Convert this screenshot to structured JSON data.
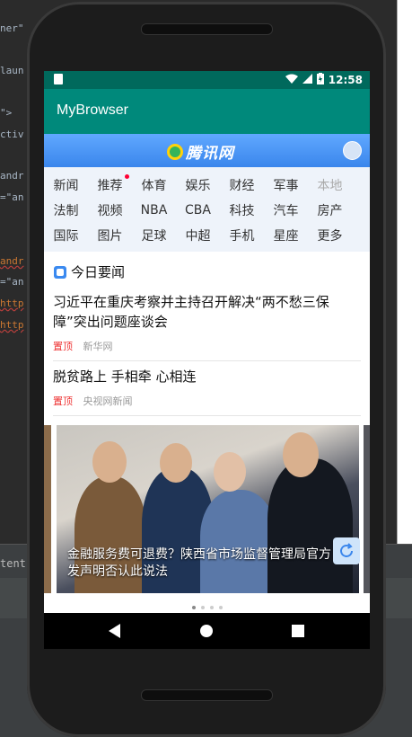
{
  "ide": {
    "left_lines": [
      "ner\"",
      "laun",
      "\">",
      "ctiv",
      "andr",
      "=\"an",
      "andr",
      "=\"an",
      "http",
      "http"
    ],
    "bottom_text": "tent-"
  },
  "status_bar": {
    "time": "12:58"
  },
  "app_bar": {
    "title": "MyBrowser"
  },
  "site_header": {
    "logo_text": "腾讯网"
  },
  "channels": [
    [
      {
        "label": "新闻"
      },
      {
        "label": "推荐",
        "dot": true
      },
      {
        "label": "体育"
      },
      {
        "label": "娱乐"
      },
      {
        "label": "财经"
      },
      {
        "label": "军事"
      },
      {
        "label": "本地",
        "dim": true
      }
    ],
    [
      {
        "label": "法制"
      },
      {
        "label": "视频"
      },
      {
        "label": "NBA"
      },
      {
        "label": "CBA"
      },
      {
        "label": "科技"
      },
      {
        "label": "汽车"
      },
      {
        "label": "房产"
      }
    ],
    [
      {
        "label": "国际"
      },
      {
        "label": "图片"
      },
      {
        "label": "足球"
      },
      {
        "label": "中超"
      },
      {
        "label": "手机"
      },
      {
        "label": "星座"
      },
      {
        "label": "更多"
      }
    ]
  ],
  "section": {
    "title": "今日要闻"
  },
  "news": [
    {
      "title": "习近平在重庆考察并主持召开解决“两不愁三保障”突出问题座谈会",
      "tag": "置顶",
      "source": "新华网"
    },
    {
      "title": "脱贫路上 手相牵 心相连",
      "tag": "置顶",
      "source": "央视网新闻"
    }
  ],
  "carousel": {
    "caption": "金融服务费可退费？陕西省市场监督管理局官方发声明否认此说法",
    "dots": 4,
    "active": 0
  },
  "colors": {
    "status": "#00695c",
    "appbar": "#00897b",
    "accent": "#3a86ec"
  }
}
